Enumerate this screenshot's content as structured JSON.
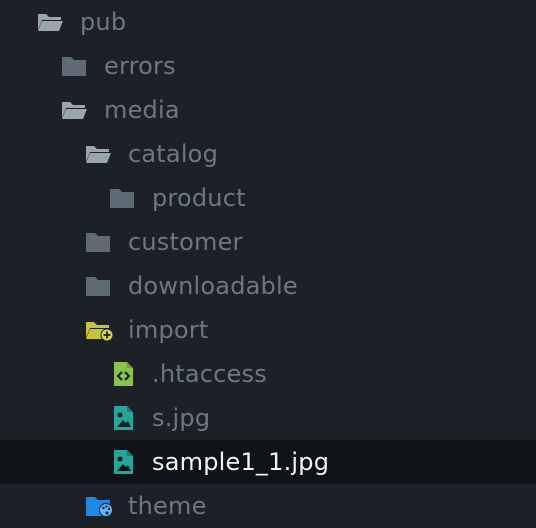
{
  "tree": {
    "items": [
      {
        "label": "pub",
        "icon": "folder-open-icon"
      },
      {
        "label": "errors",
        "icon": "folder-closed-icon"
      },
      {
        "label": "media",
        "icon": "folder-open-icon"
      },
      {
        "label": "catalog",
        "icon": "folder-open-icon"
      },
      {
        "label": "product",
        "icon": "folder-closed-icon"
      },
      {
        "label": "customer",
        "icon": "folder-closed-icon"
      },
      {
        "label": "downloadable",
        "icon": "folder-closed-icon"
      },
      {
        "label": "import",
        "icon": "folder-import-icon"
      },
      {
        "label": ".htaccess",
        "icon": "code-file-icon"
      },
      {
        "label": "s.jpg",
        "icon": "image-file-icon"
      },
      {
        "label": "sample1_1.jpg",
        "icon": "image-file-icon",
        "selected": true
      },
      {
        "label": "theme",
        "icon": "folder-theme-icon"
      }
    ]
  },
  "colors": {
    "background": "#1c2127",
    "selected_row": "#0f1317",
    "text": "#6d7780",
    "selected_text": "#f2f4f5",
    "folder": "#9aa6ae",
    "folder_closed": "#5f6b74",
    "import_folder": "#c4c53b",
    "htaccess_icon": "#8bc34a",
    "image_icon": "#26a69a",
    "theme_folder": "#1e88e5"
  }
}
